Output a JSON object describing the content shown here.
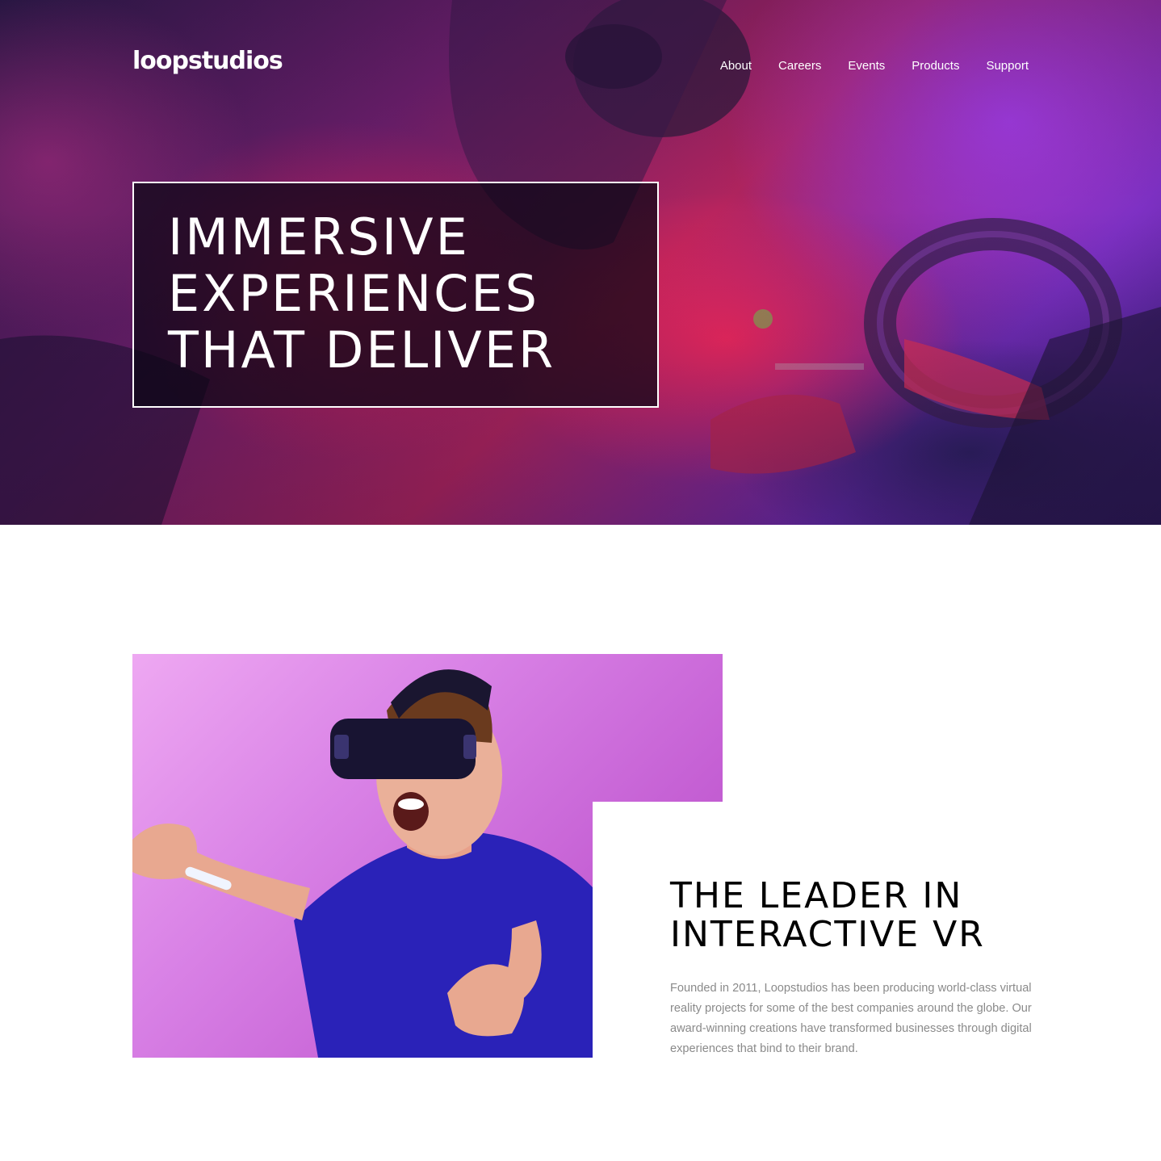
{
  "header": {
    "logo": "loopstudios",
    "nav": [
      "About",
      "Careers",
      "Events",
      "Products",
      "Support"
    ]
  },
  "hero": {
    "title_lines": [
      "IMMERSIVE",
      "EXPERIENCES",
      "THAT DELIVER"
    ]
  },
  "about": {
    "title_lines": [
      "THE LEADER IN",
      "INTERACTIVE VR"
    ],
    "text": "Founded in 2011, Loopstudios has been producing world-class virtual reality projects for some of the best companies around the globe. Our award-winning creations have transformed businesses through digital experiences that bind to their brand."
  },
  "colors": {
    "hero_overlay": "#0a0614",
    "about_bg": "#d982e6",
    "about_text": "#8a8a8a",
    "accent_shirt": "#2a22b8"
  }
}
